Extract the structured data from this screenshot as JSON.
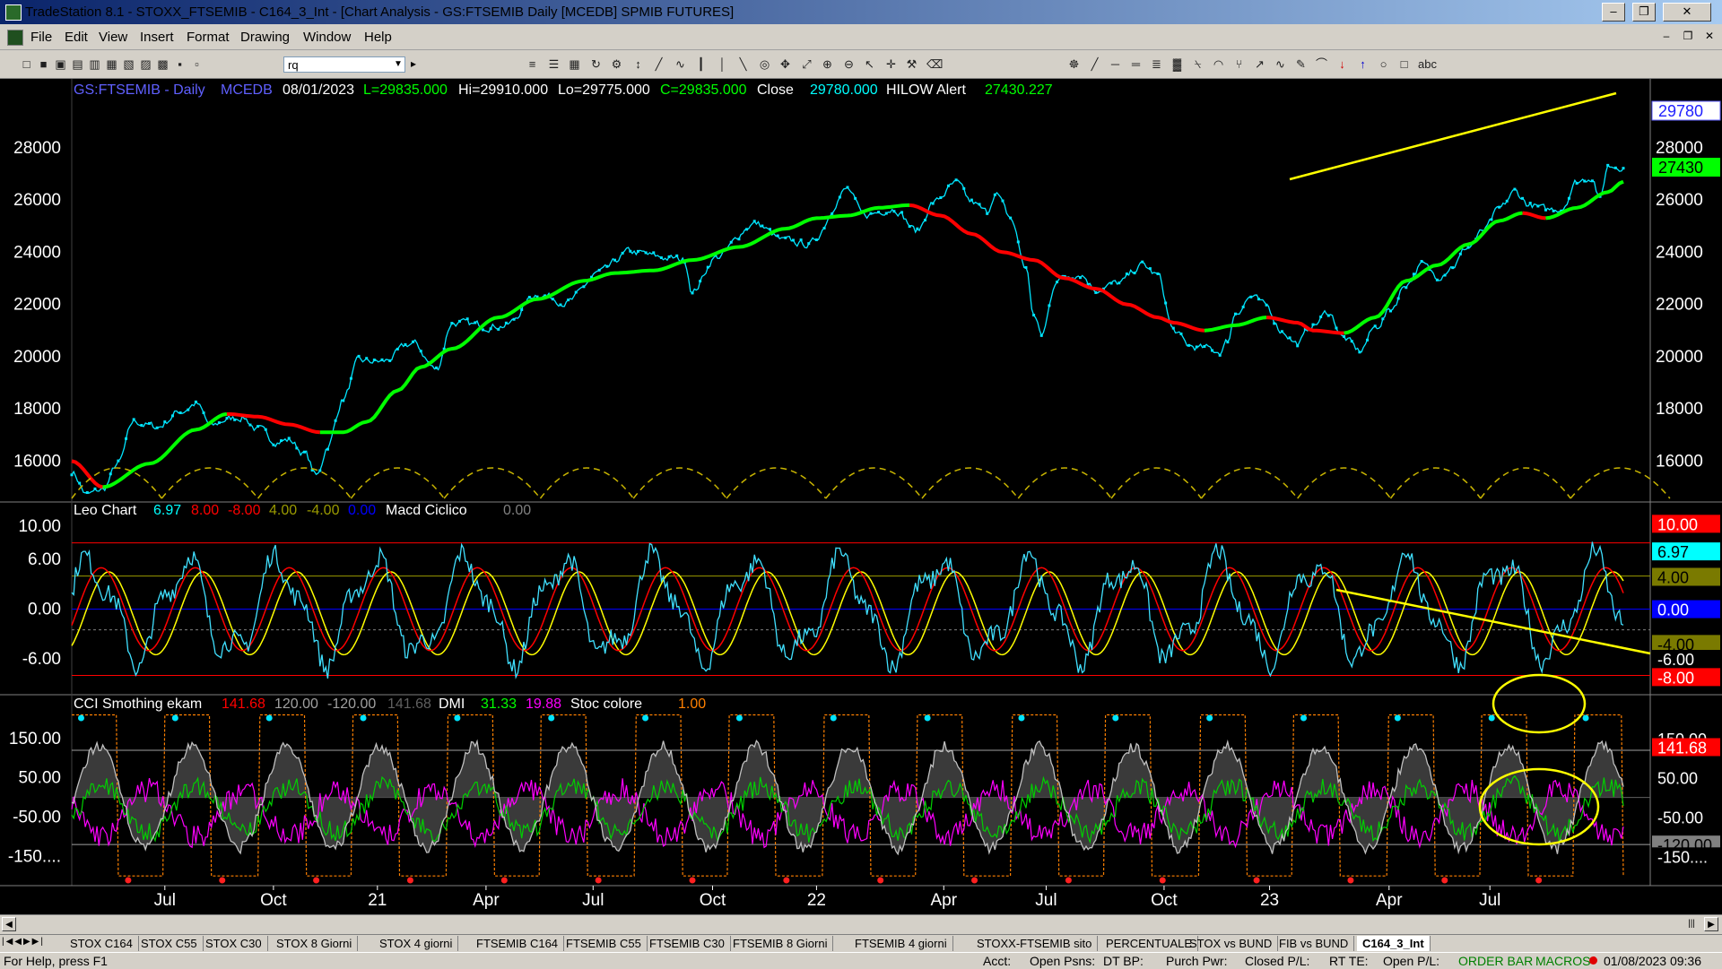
{
  "window": {
    "title": "TradeStation 8.1 - STOXX_FTSEMIB - C164_3_Int - [Chart Analysis - GS:FTSEMIB  Daily  [MCEDB] SPMIB FUTURES]",
    "min_label": "–",
    "max_label": "❐",
    "close_label": "✕",
    "mdi_min_label": "–",
    "mdi_max_label": "❐",
    "mdi_close_label": "✕"
  },
  "menu": [
    "File",
    "Edit",
    "View",
    "Insert",
    "Format",
    "Drawing",
    "Window",
    "Help"
  ],
  "toolbar": {
    "symbol_value": "rq",
    "icons_left": [
      "new-icon",
      "open-icon",
      "save-icon",
      "folder-icon",
      "print-icon",
      "print-preview-icon",
      "chart-icon",
      "grid-icon",
      "lock-icon",
      "link-icon",
      "globe-icon"
    ],
    "icons_right": [
      "layout-icon",
      "layout2-icon",
      "table-icon",
      "refresh-icon",
      "format-icon",
      "scale-icon",
      "trendline-icon",
      "indicator-icon",
      "bar-icon",
      "candle-icon",
      "line-chart-icon",
      "style-icon",
      "move-icon",
      "resize-icon",
      "zoom-in-icon",
      "zoom-out-icon",
      "pointer-icon",
      "crosshair-icon",
      "tools-icon",
      "eraser-icon",
      "settings-icon",
      "draw-line-icon",
      "horizontal-line-icon",
      "channel-icon",
      "fib-icon",
      "gann-icon",
      "fan-icon",
      "arc-icon",
      "pitchfork-icon",
      "arrow-icon",
      "cycle-icon",
      "pen-icon",
      "curve-icon",
      "arrow-down-icon",
      "arrow-up-icon",
      "ellipse-icon",
      "rectangle-icon",
      "text-icon"
    ]
  },
  "price_panel": {
    "header": {
      "symbol": "GS:FTSEMIB - Daily",
      "data_source": "MCEDB",
      "date": "08/01/2023",
      "last": "L=29835.000",
      "high": "Hi=29910.000",
      "low": "Lo=29775.000",
      "close_eq": "C=29835.000",
      "close_label": "Close",
      "close_value": "29780.000",
      "alert_label": "HILOW Alert",
      "alert_value": "27430.227"
    },
    "y_ticks": [
      "28000",
      "26000",
      "24000",
      "22000",
      "20000",
      "18000",
      "16000"
    ],
    "y_tick_values": [
      28000,
      26000,
      24000,
      22000,
      20000,
      18000,
      16000
    ],
    "y_range": [
      14500,
      30500
    ],
    "last_price_tag": "29780",
    "alert_tag": "27430",
    "colors": {
      "price": "#00e5ff",
      "ma_up": "#00ff00",
      "ma_down": "#ff0000",
      "trendline": "#ffff00",
      "cycles": "#c8b400"
    }
  },
  "osc_panel": {
    "header": {
      "name": "Leo Chart",
      "v1": "6.97",
      "v2": "8.00",
      "v3": "-8.00",
      "v4": "4.00",
      "v5": "-4.00",
      "v6": "0.00",
      "macd_name": "Macd Ciclico",
      "macd_value": "0.00"
    },
    "y_ticks": [
      "10.00",
      "6.00",
      "0.00",
      "-6.00"
    ],
    "y_tick_values": [
      10,
      6,
      0,
      -6
    ],
    "y_range": [
      -10,
      12.5
    ],
    "level_lines": [
      8,
      4,
      0,
      -2.5,
      -8
    ],
    "tags": [
      {
        "label": "10.00",
        "bg": "#ff0000",
        "fg": "#ffffff",
        "value": 10.3
      },
      {
        "label": "6.97",
        "bg": "#00ffff",
        "fg": "#000000",
        "value": 6.97
      },
      {
        "label": "4.00",
        "bg": "#7a7a00",
        "fg": "#000000",
        "value": 3.9
      },
      {
        "label": "0.00",
        "bg": "#0000ff",
        "fg": "#ffffff",
        "value": 0
      },
      {
        "label": "-4.00",
        "bg": "#7a7a00",
        "fg": "#000000",
        "value": -4.2
      },
      {
        "label": "-6.00",
        "bg": "#000000",
        "fg": "#ffffff",
        "value": -6
      },
      {
        "label": "-8.00",
        "bg": "#ff0000",
        "fg": "#ffffff",
        "value": -8.2
      }
    ]
  },
  "cci_panel": {
    "header": {
      "name": "CCI Smothing ekam",
      "v1": "141.68",
      "v2": "120.00",
      "v3": "-120.00",
      "v4": "141.68",
      "dmi_label": "DMI",
      "dmi1": "31.33",
      "dmi2": "19.88",
      "stoc_label": "Stoc colore",
      "stoc_value": "1.00"
    },
    "y_ticks": [
      "150.00",
      "50.00",
      "-50.00",
      "-150...."
    ],
    "y_tick_values": [
      150,
      50,
      -50,
      -150
    ],
    "y_range": [
      -220,
      250
    ],
    "level_lines": [
      120,
      -120
    ],
    "tags": [
      {
        "label": "150.00",
        "bg": "#000000",
        "fg": "#ffffff",
        "value": 150
      },
      {
        "label": "141.68",
        "bg": "#ff0000",
        "fg": "#ffffff",
        "value": 128
      },
      {
        "label": "50.00",
        "bg": "#000000",
        "fg": "#ffffff",
        "value": 50
      },
      {
        "label": "-50.00",
        "bg": "#000000",
        "fg": "#ffffff",
        "value": -50
      },
      {
        "label": "-120.00",
        "bg": "#808080",
        "fg": "#000000",
        "value": -120
      },
      {
        "label": "-150....",
        "bg": "#000000",
        "fg": "#ffffff",
        "value": -150
      }
    ]
  },
  "x_axis": {
    "labels": [
      {
        "text": "Jul",
        "t": 0.06
      },
      {
        "text": "Oct",
        "t": 0.13
      },
      {
        "text": "21",
        "t": 0.197
      },
      {
        "text": "Apr",
        "t": 0.267
      },
      {
        "text": "Jul",
        "t": 0.336
      },
      {
        "text": "Oct",
        "t": 0.413
      },
      {
        "text": "22",
        "t": 0.48
      },
      {
        "text": "Apr",
        "t": 0.562
      },
      {
        "text": "Jul",
        "t": 0.628
      },
      {
        "text": "Oct",
        "t": 0.704
      },
      {
        "text": "23",
        "t": 0.772
      },
      {
        "text": "Apr",
        "t": 0.849
      },
      {
        "text": "Jul",
        "t": 0.914
      }
    ]
  },
  "tabs": [
    "STOX C164",
    "STOX C55",
    "STOX  C30",
    "STOX  8 Giorni",
    "STOX 4 giorni",
    "FTSEMIB C164",
    "FTSEMIB C55",
    "FTSEMIB C30",
    "FTSEMIB  8 Giorni",
    "FTSEMIB  4 giorni",
    "STOXX-FTSEMIB sito",
    "PERCENTUALE",
    "STOX vs BUND",
    "FIB vs BUND",
    "C164_3_Int"
  ],
  "active_tab_index": 14,
  "status": {
    "help": "For Help, press F1",
    "acct": "Acct:",
    "open_psns": "Open Psns:",
    "dt_bp": "DT BP:",
    "purch_pwr": "Purch Pwr:",
    "closed_pl": "Closed P/L:",
    "rt_te": "RT TE:",
    "open_pl": "Open P/L:",
    "order_bar": "ORDER BAR",
    "macros": "MACROS",
    "datetime": "01/08/2023 09:36"
  },
  "chart_data": [
    {
      "type": "line",
      "title": "GS:FTSEMIB - Daily",
      "x_start": "2020-06",
      "x_end": "2023-08",
      "ylim": [
        14500,
        30500
      ],
      "series": [
        {
          "name": "Close",
          "anchors": [
            [
              0.0,
              15600
            ],
            [
              0.01,
              14700
            ],
            [
              0.02,
              14900
            ],
            [
              0.03,
              15900
            ],
            [
              0.04,
              17500
            ],
            [
              0.055,
              17300
            ],
            [
              0.07,
              17900
            ],
            [
              0.08,
              18200
            ],
            [
              0.09,
              17300
            ],
            [
              0.1,
              17600
            ],
            [
              0.11,
              17700
            ],
            [
              0.12,
              17200
            ],
            [
              0.13,
              16800
            ],
            [
              0.14,
              16800
            ],
            [
              0.15,
              16300
            ],
            [
              0.158,
              15400
            ],
            [
              0.165,
              16600
            ],
            [
              0.175,
              18400
            ],
            [
              0.185,
              19800
            ],
            [
              0.2,
              19800
            ],
            [
              0.22,
              20500
            ],
            [
              0.235,
              19500
            ],
            [
              0.245,
              21300
            ],
            [
              0.26,
              21200
            ],
            [
              0.28,
              21200
            ],
            [
              0.3,
              22400
            ],
            [
              0.32,
              22100
            ],
            [
              0.34,
              23200
            ],
            [
              0.36,
              24000
            ],
            [
              0.38,
              23800
            ],
            [
              0.395,
              23700
            ],
            [
              0.4,
              22500
            ],
            [
              0.415,
              23800
            ],
            [
              0.44,
              25100
            ],
            [
              0.46,
              24400
            ],
            [
              0.475,
              24300
            ],
            [
              0.5,
              26400
            ],
            [
              0.51,
              25400
            ],
            [
              0.53,
              25700
            ],
            [
              0.545,
              24800
            ],
            [
              0.555,
              25900
            ],
            [
              0.57,
              26600
            ],
            [
              0.58,
              25900
            ],
            [
              0.59,
              25500
            ],
            [
              0.595,
              26300
            ],
            [
              0.605,
              25300
            ],
            [
              0.615,
              23400
            ],
            [
              0.62,
              21600
            ],
            [
              0.625,
              20800
            ],
            [
              0.635,
              23000
            ],
            [
              0.65,
              23200
            ],
            [
              0.66,
              22600
            ],
            [
              0.675,
              22800
            ],
            [
              0.69,
              23500
            ],
            [
              0.7,
              23100
            ],
            [
              0.71,
              21000
            ],
            [
              0.72,
              20400
            ],
            [
              0.73,
              20300
            ],
            [
              0.74,
              20200
            ],
            [
              0.745,
              20600
            ],
            [
              0.75,
              21700
            ],
            [
              0.76,
              22300
            ],
            [
              0.77,
              21900
            ],
            [
              0.78,
              21000
            ],
            [
              0.79,
              20500
            ],
            [
              0.8,
              21200
            ],
            [
              0.81,
              21700
            ],
            [
              0.82,
              20700
            ],
            [
              0.83,
              20200
            ],
            [
              0.84,
              21100
            ],
            [
              0.85,
              21800
            ],
            [
              0.86,
              22800
            ],
            [
              0.87,
              23500
            ],
            [
              0.88,
              23100
            ],
            [
              0.89,
              23500
            ],
            [
              0.9,
              24200
            ],
            [
              0.91,
              24800
            ],
            [
              0.92,
              25600
            ],
            [
              0.93,
              26300
            ],
            [
              0.94,
              25800
            ],
            [
              0.95,
              25600
            ],
            [
              0.96,
              25700
            ],
            [
              0.97,
              26700
            ],
            [
              0.98,
              26900
            ],
            [
              0.985,
              26000
            ],
            [
              0.99,
              27300
            ],
            [
              1.0,
              27300
            ]
          ]
        },
        {
          "name": "HILOW Alert",
          "anchors": [
            [
              0.0,
              16000
            ],
            [
              0.02,
              15000
            ],
            [
              0.05,
              15900
            ],
            [
              0.08,
              17200
            ],
            [
              0.1,
              17800
            ],
            [
              0.12,
              17700
            ],
            [
              0.14,
              17400
            ],
            [
              0.16,
              17100
            ],
            [
              0.175,
              17100
            ],
            [
              0.19,
              17500
            ],
            [
              0.21,
              18700
            ],
            [
              0.225,
              19600
            ],
            [
              0.245,
              20300
            ],
            [
              0.275,
              21500
            ],
            [
              0.3,
              22200
            ],
            [
              0.33,
              22900
            ],
            [
              0.35,
              23200
            ],
            [
              0.375,
              23300
            ],
            [
              0.4,
              23700
            ],
            [
              0.43,
              24200
            ],
            [
              0.46,
              24900
            ],
            [
              0.48,
              25300
            ],
            [
              0.5,
              25400
            ],
            [
              0.52,
              25700
            ],
            [
              0.54,
              25800
            ],
            [
              0.56,
              25400
            ],
            [
              0.58,
              24700
            ],
            [
              0.6,
              24000
            ],
            [
              0.62,
              23700
            ],
            [
              0.64,
              23000
            ],
            [
              0.66,
              22600
            ],
            [
              0.68,
              22000
            ],
            [
              0.7,
              21500
            ],
            [
              0.71,
              21300
            ],
            [
              0.73,
              21000
            ],
            [
              0.75,
              21200
            ],
            [
              0.77,
              21500
            ],
            [
              0.79,
              21300
            ],
            [
              0.8,
              21000
            ],
            [
              0.82,
              20900
            ],
            [
              0.84,
              21500
            ],
            [
              0.86,
              22900
            ],
            [
              0.88,
              23500
            ],
            [
              0.9,
              24300
            ],
            [
              0.92,
              25200
            ],
            [
              0.935,
              25500
            ],
            [
              0.95,
              25300
            ],
            [
              0.97,
              25700
            ],
            [
              0.99,
              26300
            ],
            [
              1.0,
              26700
            ]
          ]
        }
      ]
    },
    {
      "type": "line",
      "title": "Leo Chart",
      "ylim": [
        -10,
        12.5
      ],
      "series": [
        {
          "name": "Leo Chart",
          "current": 6.97
        },
        {
          "name": "Macd Ciclico",
          "current": 0.0
        }
      ]
    },
    {
      "type": "line",
      "title": "CCI Smothing ekam",
      "ylim": [
        -220,
        250
      ],
      "series": [
        {
          "name": "CCI Smothing ekam",
          "current": 141.68
        },
        {
          "name": "DMI+",
          "current": 31.33
        },
        {
          "name": "DMI-",
          "current": 19.88
        },
        {
          "name": "Stoc colore",
          "current": 1.0
        }
      ]
    }
  ]
}
